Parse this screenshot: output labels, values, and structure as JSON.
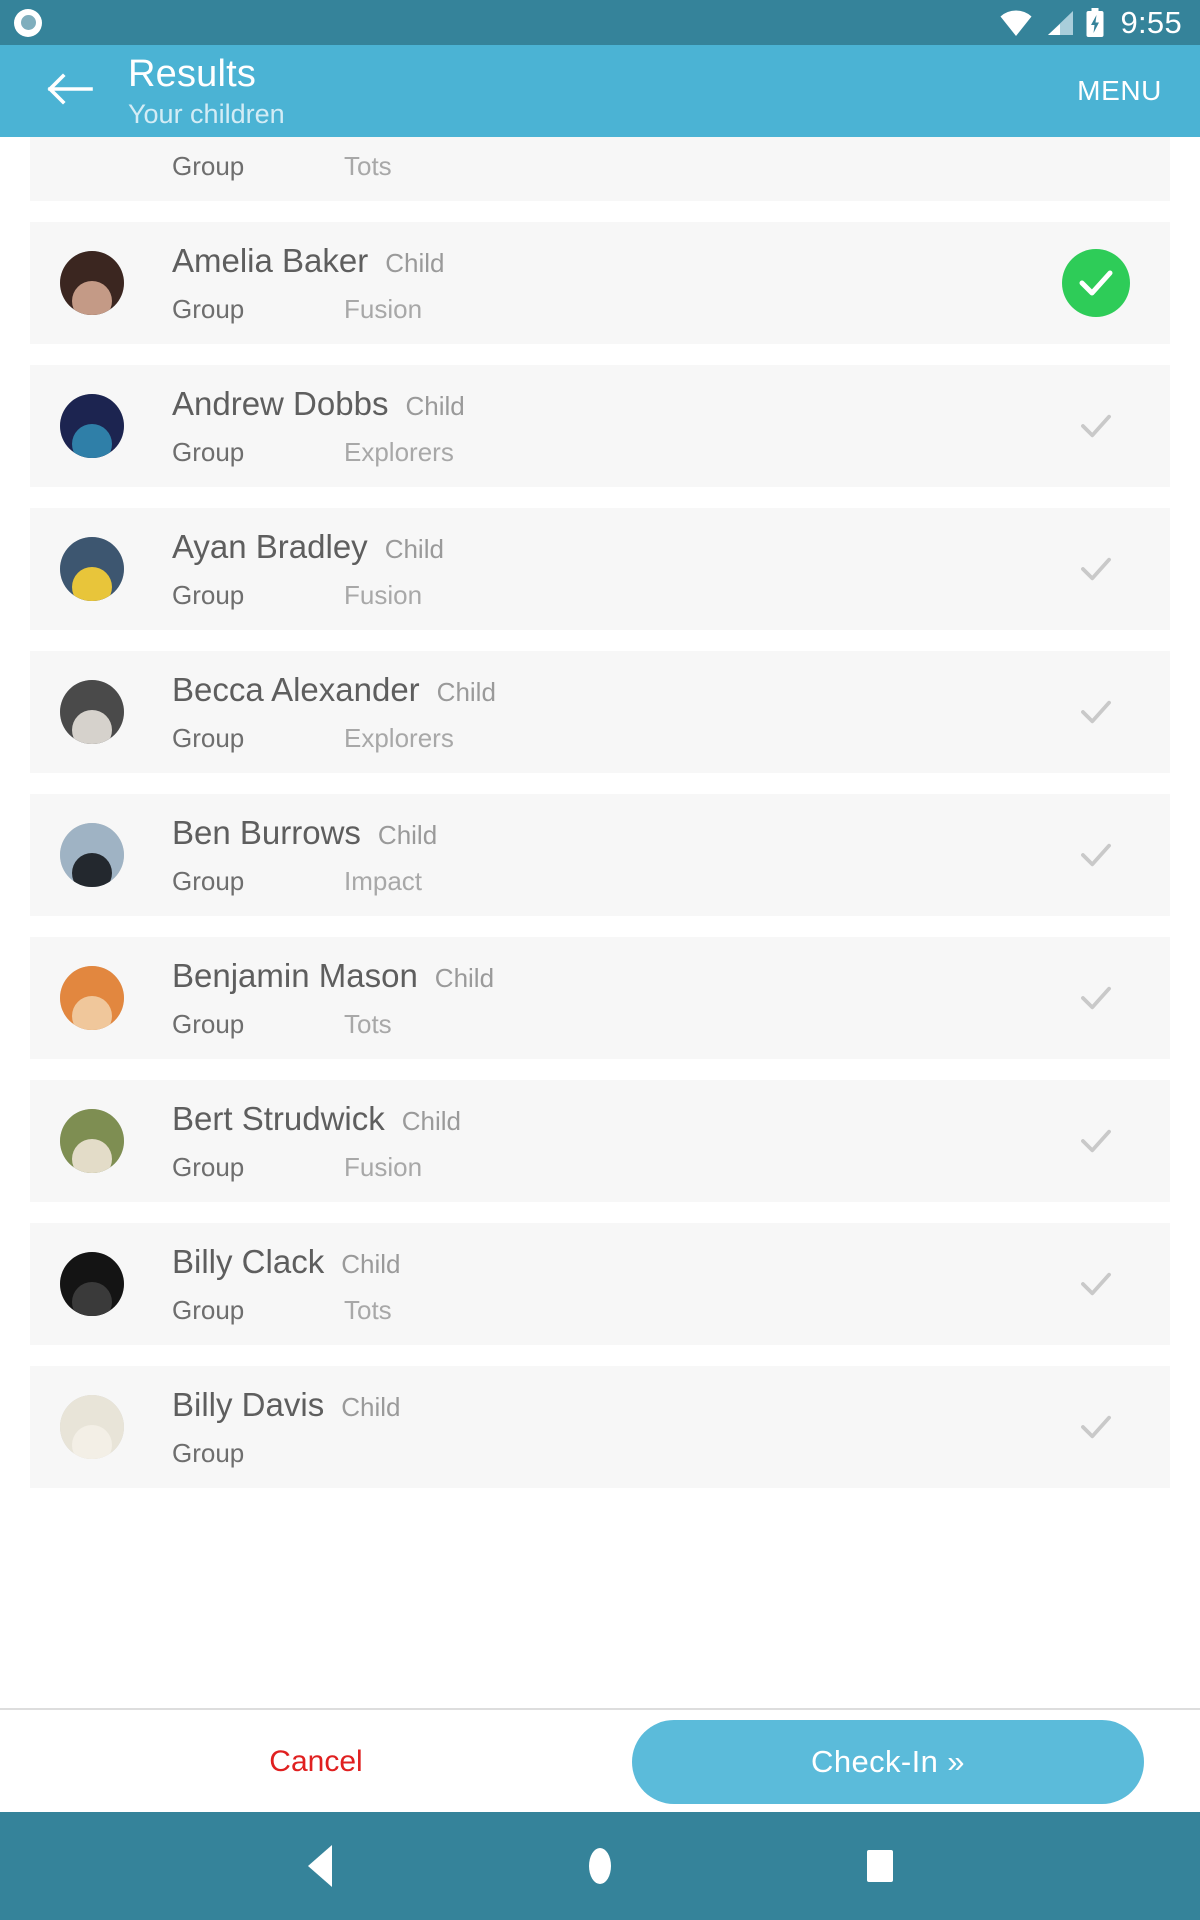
{
  "status_bar": {
    "time": "9:55",
    "icons": [
      "screen-record-icon",
      "wifi-icon",
      "cellular-signal-icon",
      "battery-charging-icon"
    ]
  },
  "app_bar": {
    "back_icon": "arrow-left-icon",
    "title": "Results",
    "subtitle": "Your children",
    "menu_label": "MENU"
  },
  "list": {
    "group_label": "Group",
    "type_label": "Child",
    "partial_top_row": {
      "group_label": "Group",
      "group_value": "Tots"
    },
    "people": [
      {
        "name": "Amelia Baker",
        "type": "Child",
        "group_label": "Group",
        "group": "Fusion",
        "selected": true,
        "avatar_bg": "#3B2620",
        "avatar_fg": "#C49A86"
      },
      {
        "name": "Andrew Dobbs",
        "type": "Child",
        "group_label": "Group",
        "group": "Explorers",
        "selected": false,
        "avatar_bg": "#1C2450",
        "avatar_fg": "#2F7FA8"
      },
      {
        "name": "Ayan Bradley",
        "type": "Child",
        "group_label": "Group",
        "group": "Fusion",
        "selected": false,
        "avatar_bg": "#3D5670",
        "avatar_fg": "#E8C53A"
      },
      {
        "name": "Becca Alexander",
        "type": "Child",
        "group_label": "Group",
        "group": "Explorers",
        "selected": false,
        "avatar_bg": "#4A4A4A",
        "avatar_fg": "#D6D2CC"
      },
      {
        "name": "Ben Burrows",
        "type": "Child",
        "group_label": "Group",
        "group": "Impact",
        "selected": false,
        "avatar_bg": "#9FB3C4",
        "avatar_fg": "#23282E"
      },
      {
        "name": "Benjamin Mason",
        "type": "Child",
        "group_label": "Group",
        "group": "Tots",
        "selected": false,
        "avatar_bg": "#E2873F",
        "avatar_fg": "#F0C79B"
      },
      {
        "name": "Bert Strudwick",
        "type": "Child",
        "group_label": "Group",
        "group": "Fusion",
        "selected": false,
        "avatar_bg": "#7E8E52",
        "avatar_fg": "#E3DCC8"
      },
      {
        "name": "Billy Clack",
        "type": "Child",
        "group_label": "Group",
        "group": "Tots",
        "selected": false,
        "avatar_bg": "#141414",
        "avatar_fg": "#3A3A3A"
      },
      {
        "name": "Billy Davis",
        "type": "Child",
        "group_label": "Group",
        "group": "",
        "selected": false,
        "avatar_bg": "#E8E4D8",
        "avatar_fg": "#F3EFE6"
      }
    ]
  },
  "action_bar": {
    "cancel_label": "Cancel",
    "checkin_label": "Check-In »"
  },
  "nav_bar": {
    "back_icon": "nav-back-icon",
    "home_icon": "nav-home-icon",
    "recents_icon": "nav-recents-icon"
  },
  "colors": {
    "status_bar": "#35839A",
    "app_bar": "#4BB3D4",
    "row_bg": "#F7F7F7",
    "selected_check": "#2ECC58",
    "cancel_text": "#E02020",
    "checkin_button": "#5BBBDA"
  }
}
